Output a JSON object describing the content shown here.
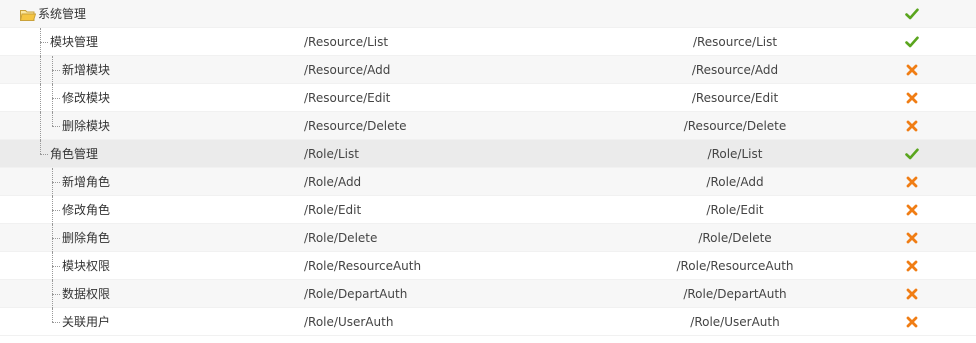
{
  "rows": [
    {
      "label": "系统管理",
      "path": "",
      "url": "",
      "status": "check"
    },
    {
      "label": "模块管理",
      "path": "/Resource/List",
      "url": "/Resource/List",
      "status": "check"
    },
    {
      "label": "新增模块",
      "path": "/Resource/Add",
      "url": "/Resource/Add",
      "status": "cross"
    },
    {
      "label": "修改模块",
      "path": "/Resource/Edit",
      "url": "/Resource/Edit",
      "status": "cross"
    },
    {
      "label": "删除模块",
      "path": "/Resource/Delete",
      "url": "/Resource/Delete",
      "status": "cross"
    },
    {
      "label": "角色管理",
      "path": "/Role/List",
      "url": "/Role/List",
      "status": "check"
    },
    {
      "label": "新增角色",
      "path": "/Role/Add",
      "url": "/Role/Add",
      "status": "cross"
    },
    {
      "label": "修改角色",
      "path": "/Role/Edit",
      "url": "/Role/Edit",
      "status": "cross"
    },
    {
      "label": "删除角色",
      "path": "/Role/Delete",
      "url": "/Role/Delete",
      "status": "cross"
    },
    {
      "label": "模块权限",
      "path": "/Role/ResourceAuth",
      "url": "/Role/ResourceAuth",
      "status": "cross"
    },
    {
      "label": "数据权限",
      "path": "/Role/DepartAuth",
      "url": "/Role/DepartAuth",
      "status": "cross"
    },
    {
      "label": "关联用户",
      "path": "/Role/UserAuth",
      "url": "/Role/UserAuth",
      "status": "cross"
    }
  ],
  "colors": {
    "check": "#5aa51e",
    "cross": "#f07d14",
    "folder": "#f5c542",
    "alt_row": "#f7f7f7",
    "selected_row": "#ebebeb"
  },
  "icons": {
    "root": "folder-open-icon",
    "enabled": "check-icon",
    "disabled": "cross-icon"
  }
}
